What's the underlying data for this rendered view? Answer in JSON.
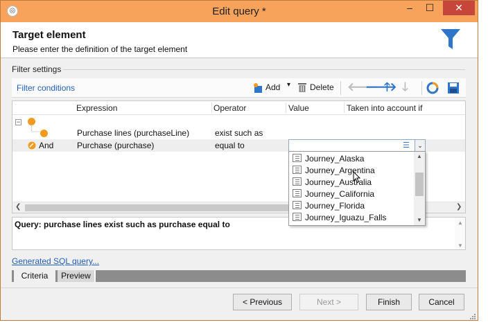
{
  "window": {
    "title": "Edit query *",
    "minimize": "–",
    "maximize": "☐",
    "close": "✕"
  },
  "header": {
    "title": "Target element",
    "subtitle": "Please enter the definition of the target element"
  },
  "filter_settings": {
    "label": "Filter settings",
    "conditions_label": "Filter conditions",
    "toolbar": {
      "add": "Add",
      "add_arrow": "▾",
      "delete": "Delete"
    }
  },
  "grid": {
    "columns": [
      "Expression",
      "Operator",
      "Value",
      "Taken into account if"
    ],
    "rows": [
      {
        "prefix": "",
        "expression": "Purchase lines (purchaseLine)",
        "operator": "exist such as",
        "value": ""
      },
      {
        "prefix": "And",
        "expression": "Purchase (purchase)",
        "operator": "equal to",
        "value": ""
      }
    ]
  },
  "dropdown": {
    "items": [
      "Journey_Alaska",
      "Journey_Argentina",
      "Journey_Australia",
      "Journey_California",
      "Journey_Florida",
      "Journey_Iguazu_Falls"
    ]
  },
  "query_summary": "Query: purchase lines exist such as purchase equal to",
  "sql_link": "Generated SQL query...",
  "tabs": [
    "Criteria",
    "Preview"
  ],
  "buttons": {
    "previous": "< Previous",
    "next": "Next >",
    "finish": "Finish",
    "cancel": "Cancel"
  },
  "colors": {
    "title_bar": "#f7a35c",
    "close_button": "#c7463b",
    "link": "#2160b8",
    "accent_blue": "#2f75c9",
    "node_orange": "#f29b1f"
  }
}
